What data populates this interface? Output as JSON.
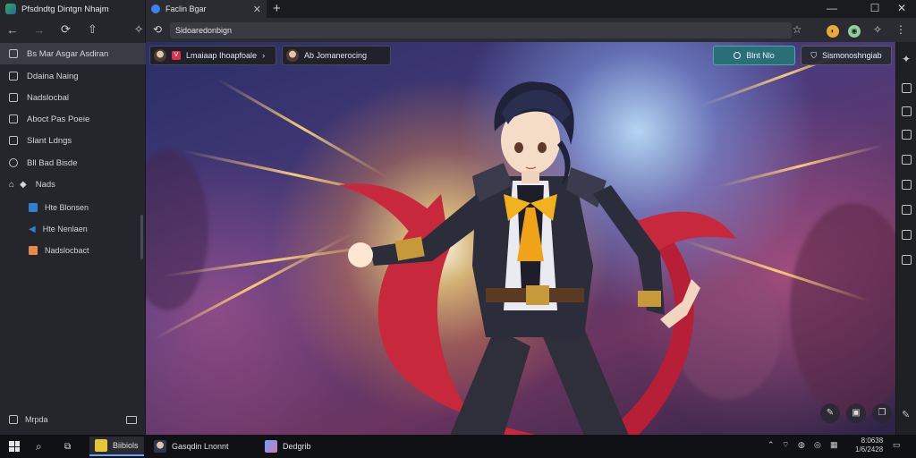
{
  "sidebar": {
    "title": "Pfsdndtg Dintgn Nhajm",
    "items": [
      {
        "label": "Bs Mar Asgar Asdiran"
      },
      {
        "label": "Ddaina Naing"
      },
      {
        "label": "Nadslocbal"
      },
      {
        "label": "Aboct Pas Poeie"
      },
      {
        "label": "Slant Ldngs"
      },
      {
        "label": "Bll Bad Bisde"
      },
      {
        "label": "Nads"
      }
    ],
    "subitems": [
      {
        "label": "Hte Blonsen",
        "color": "#2f7fd0"
      },
      {
        "label": "Hte Nenlaen",
        "color": "#2f7fd0"
      },
      {
        "label": "Nadslocbact",
        "color": "#e8894a"
      }
    ],
    "bottom_label": "Mrpda"
  },
  "tab": {
    "title": "Faclin Bgar"
  },
  "address": {
    "url": "Sidoaredonbign"
  },
  "overlay": {
    "chip1": "Lmaiaap Ihoapfoale",
    "chip1_badge": "V",
    "chip2": "Ab Jomanerocing",
    "btn_primary": "Blnt   Nlo",
    "btn_secondary": "Sismonoshngiab"
  },
  "taskbar": {
    "app1": "Biibiols",
    "app2": "Gasqdin Lnonnt",
    "app3": "Dedgrib",
    "clock_time": "8:0638",
    "clock_date": "1/6/2428"
  },
  "colors": {
    "accent": "#2a6f78",
    "active_tab": "#6aa2ff"
  }
}
